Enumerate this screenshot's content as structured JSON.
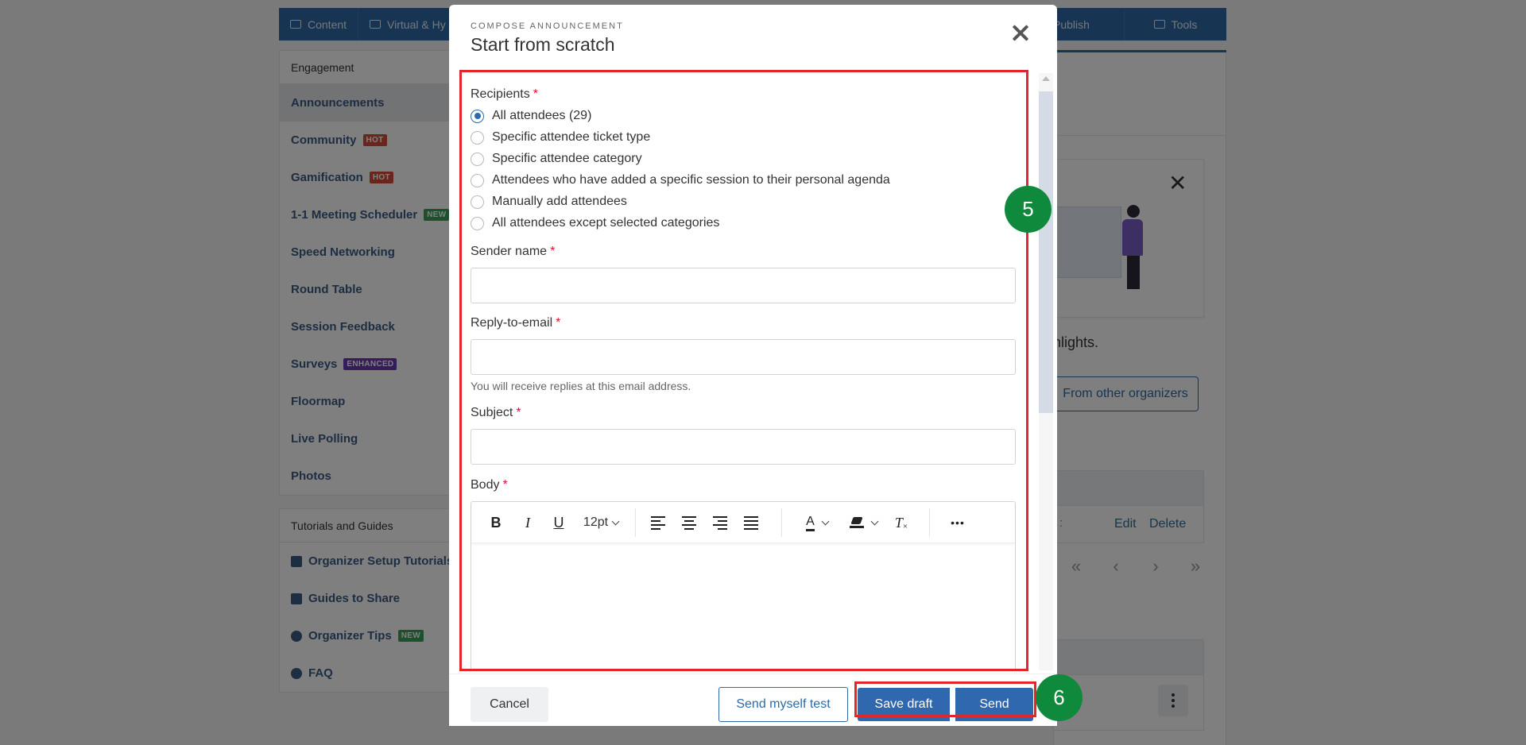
{
  "background": {
    "topnav": {
      "tabs": [
        {
          "label": "Content",
          "icon": "list-icon"
        },
        {
          "label": "Virtual & Hy",
          "icon": "laptop-icon"
        }
      ],
      "publish_label": "Publish",
      "tools_label": "Tools"
    },
    "sidebar": {
      "engagement_heading": "Engagement",
      "items": [
        {
          "label": "Announcements",
          "badge": ""
        },
        {
          "label": "Community",
          "badge": "HOT"
        },
        {
          "label": "Gamification",
          "badge": "HOT"
        },
        {
          "label": "1-1 Meeting Scheduler",
          "badge": "NEW"
        },
        {
          "label": "Speed Networking",
          "badge": ""
        },
        {
          "label": "Round Table",
          "badge": ""
        },
        {
          "label": "Session Feedback",
          "badge": ""
        },
        {
          "label": "Surveys",
          "badge": "ENHANCED"
        },
        {
          "label": "Floormap",
          "badge": ""
        },
        {
          "label": "Live Polling",
          "badge": ""
        },
        {
          "label": "Photos",
          "badge": ""
        }
      ],
      "tutorials_heading": "Tutorials and Guides",
      "tutorial_items": [
        {
          "label": "Organizer Setup Tutorials",
          "badge": ""
        },
        {
          "label": "Guides to Share",
          "badge": ""
        },
        {
          "label": "Organizer Tips",
          "badge": "NEW"
        },
        {
          "label": "FAQ",
          "badge": ""
        }
      ]
    },
    "main": {
      "highlights_text": "hlights.",
      "other_organizers_button": "From other organizers",
      "row_truncated": ":",
      "edit_link": "Edit",
      "delete_link": "Delete"
    }
  },
  "modal": {
    "eyebrow": "COMPOSE ANNOUNCEMENT",
    "title": "Start from scratch",
    "recipients": {
      "label": "Recipients",
      "required_mark": "*",
      "options": [
        {
          "label": "All attendees (29)",
          "checked": true
        },
        {
          "label": "Specific attendee ticket type",
          "checked": false
        },
        {
          "label": "Specific attendee category",
          "checked": false
        },
        {
          "label": "Attendees who have added a specific session to their personal agenda",
          "checked": false
        },
        {
          "label": "Manually add attendees",
          "checked": false
        },
        {
          "label": "All attendees except selected categories",
          "checked": false
        }
      ]
    },
    "sender_name": {
      "label": "Sender name",
      "required_mark": "*",
      "value": "",
      "placeholder": ""
    },
    "reply_to": {
      "label": "Reply-to-email",
      "required_mark": "*",
      "value": "",
      "placeholder": "",
      "help": "You will receive replies at this email address."
    },
    "subject": {
      "label": "Subject",
      "required_mark": "*",
      "value": "",
      "placeholder": ""
    },
    "body": {
      "label": "Body",
      "required_mark": "*",
      "toolbar": {
        "bold": "B",
        "italic": "I",
        "underline": "U",
        "font_size": "12pt",
        "text_color": "A",
        "clear_format": "T",
        "more": "•••"
      },
      "value": ""
    },
    "footer": {
      "cancel": "Cancel",
      "send_test": "Send myself test",
      "save_draft": "Save draft",
      "send": "Send"
    }
  },
  "annotations": {
    "step_5": "5",
    "step_6": "6",
    "frame_color": "#e3262b",
    "badge_color": "#0f8a3c"
  },
  "colors": {
    "primary": "#2e6aa5",
    "button_primary": "#3068b0",
    "required": "#d13",
    "badge_hot": "#d44a3a",
    "badge_new": "#3aa35a",
    "badge_enhanced": "#6a3ab2"
  }
}
